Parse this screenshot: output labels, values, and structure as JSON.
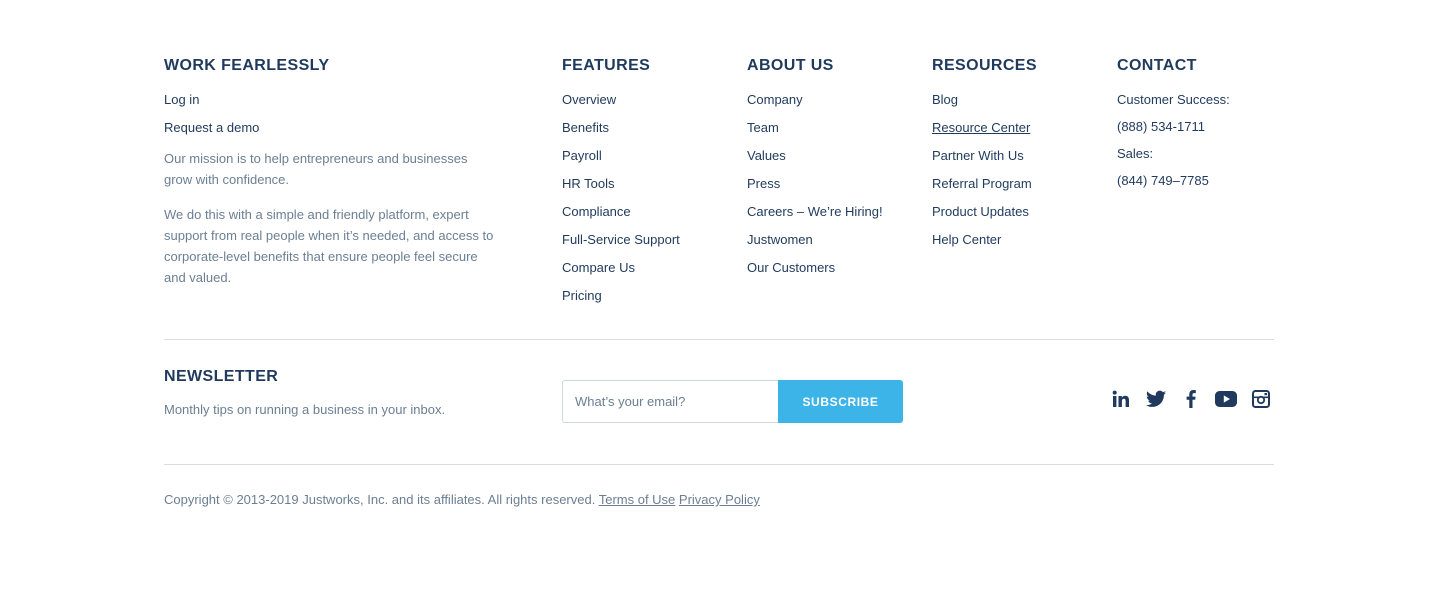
{
  "brand": {
    "heading": "WORK FEARLESSLY",
    "links": [
      "Log in",
      "Request a demo"
    ],
    "mission": "Our mission is to help entrepreneurs and businesses grow with confidence.",
    "description": "We do this with a simple and friendly platform, expert support from real people when it’s needed, and access to corporate-level benefits that ensure people feel secure and valued."
  },
  "features": {
    "heading": "FEATURES",
    "links": [
      "Overview",
      "Benefits",
      "Payroll",
      "HR Tools",
      "Compliance",
      "Full-Service Support",
      "Compare Us",
      "Pricing"
    ]
  },
  "about": {
    "heading": "ABOUT US",
    "links": [
      "Company",
      "Team",
      "Values",
      "Press",
      "Careers",
      "Justwomen",
      "Our Customers"
    ],
    "hiring_note": "– We’re Hiring!"
  },
  "resources": {
    "heading": "RESOURCES",
    "links": [
      "Blog",
      "Resource Center",
      "Partner With Us",
      "Referral Program",
      "Product Updates",
      "Help Center"
    ]
  },
  "contact": {
    "heading": "CONTACT",
    "success_label": "Customer Success:",
    "success_phone": "(888) 534-1711",
    "sales_label": "Sales:",
    "sales_phone": "(844) 749–7785"
  },
  "newsletter": {
    "heading": "NEWSLETTER",
    "subtitle": "Monthly tips on running a business in your inbox.",
    "email_placeholder": "What’s your email?",
    "email_value": "",
    "subscribe_label": "SUBSCRIBE"
  },
  "social": [
    "linkedin-icon",
    "twitter-icon",
    "facebook-icon",
    "youtube-icon",
    "instagram-icon"
  ],
  "footer": {
    "copyright": "Copyright © 2013-2019 Justworks, Inc. and its affiliates. All rights reserved.",
    "terms_label": "Terms of Use",
    "privacy_label": "Privacy Policy"
  },
  "colors": {
    "navy": "#1f3a5c",
    "muted": "#6b7f93",
    "accent": "#3cb4e7"
  }
}
